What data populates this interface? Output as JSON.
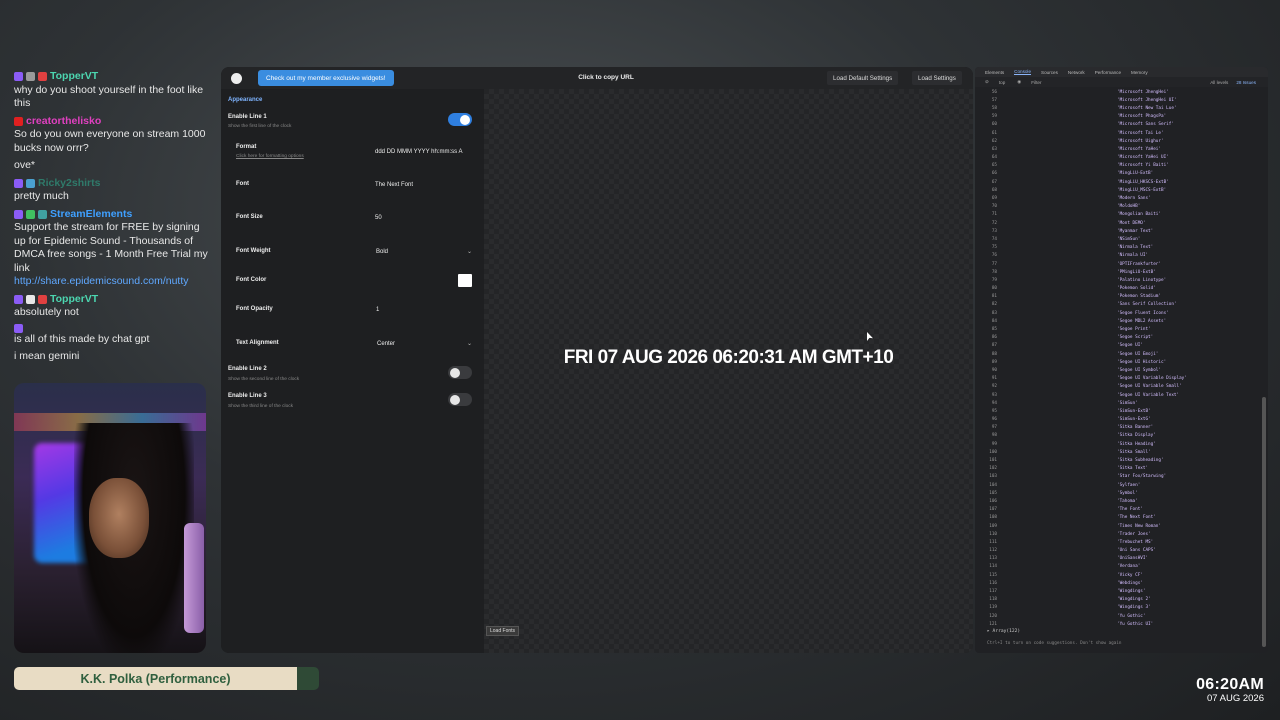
{
  "chat": [
    {
      "user": "TopperVT",
      "color": "#4cd6b0",
      "badges": [
        "#8b5cf6",
        "#9a9a9a",
        "#e04040"
      ],
      "text": "why do you shoot yourself in the foot like this"
    },
    {
      "user": "creatorthelisko",
      "color": "#e040c0",
      "badges": [
        "#e02020"
      ],
      "text": "So do you own everyone on stream 1000 bucks now orrr?"
    },
    {
      "user": "",
      "color": "#ddd",
      "badges": [],
      "text": "ove*"
    },
    {
      "user": "Ricky2shirts",
      "color": "#2f7a6a",
      "badges": [
        "#8b5cf6",
        "#4aa0d0"
      ],
      "text": "pretty much"
    },
    {
      "user": "StreamElements",
      "color": "#3fa0ff",
      "badges": [
        "#8b5cf6",
        "#40c060",
        "#40a0a0"
      ],
      "text": "Support the stream for FREE by signing up for Epidemic Sound - Thousands of DMCA free songs - 1 Month Free Trial my link",
      "link": "http://share.epidemicsound.com/nutty"
    },
    {
      "user": "TopperVT",
      "color": "#4cd6b0",
      "badges": [
        "#8b5cf6",
        "#e8e8e8",
        "#e04040"
      ],
      "text": "absolutely not"
    },
    {
      "user": "",
      "color": "#3a5fd0",
      "badges": [
        "#8b5cf6"
      ],
      "text": "is all of this made by chat gpt"
    },
    {
      "user": "",
      "color": "#ddd",
      "badges": [],
      "text": "i mean gemini"
    }
  ],
  "now_playing": "K.K. Polka (Performance)",
  "clock": {
    "time": "06:20AM",
    "date": "07 AUG 2026"
  },
  "app": {
    "member_button": "Check out my member exclusive widgets!",
    "copy_url": "Click to copy URL",
    "load_default": "Load Default Settings",
    "load_settings": "Load Settings",
    "section": "Appearance",
    "line1_label": "Enable Line 1",
    "line1_sub": "Show the first line of the clock",
    "format_label": "Format",
    "format_sub": "Click here for formatting options",
    "format_value": "ddd DD MMM YYYY hh:mm:ss A",
    "font_label": "Font",
    "font_value": "The Next Font",
    "size_label": "Font Size",
    "size_value": "50",
    "weight_label": "Font Weight",
    "weight_value": "Bold",
    "color_label": "Font Color",
    "color_value": "#ffffff",
    "opacity_label": "Font Opacity",
    "opacity_value": "1",
    "align_label": "Text Alignment",
    "align_value": "Center",
    "line2_label": "Enable Line 2",
    "line2_sub": "Show the second line of the clock",
    "line3_label": "Enable Line 3",
    "line3_sub": "Show the third line of the clock",
    "line1_enabled": true,
    "line2_enabled": false,
    "line3_enabled": false,
    "preview_text": "FRI 07 AUG 2026 06:20:31 AM GMT+10",
    "load_fonts": "Load Fonts"
  },
  "devtools": {
    "tabs": [
      "Elements",
      "Console",
      "Sources",
      "Network",
      "Performance",
      "Memory"
    ],
    "active_tab": "Console",
    "context": "top",
    "filter": "Filter",
    "levels": "All levels",
    "issues": "28 Issues",
    "start_index": 56,
    "fonts": [
      "'Microsoft JhengHei'",
      "'Microsoft JhengHei UI'",
      "'Microsoft New Tai Lue'",
      "'Microsoft PhagsPa'",
      "'Microsoft Sans Serif'",
      "'Microsoft Tai Le'",
      "'Microsoft Uighur'",
      "'Microsoft YaHei'",
      "'Microsoft YaHei UI'",
      "'Microsoft Yi Baiti'",
      "'MingLiU-ExtB'",
      "'MingLiU_HKSCS-ExtB'",
      "'MingLiU_MSCS-ExtB'",
      "'Modern Sans'",
      "'MoldoHB'",
      "'Mongolian Baiti'",
      "'Mont DEMO'",
      "'Myanmar Text'",
      "'NSimSun'",
      "'Nirmala Text'",
      "'Nirmala UI'",
      "'OPTIFrankfurter'",
      "'PMingLiU-ExtB'",
      "'Palatino Linotype'",
      "'Pokemon Solid'",
      "'Pokemon Stadium'",
      "'Sans Serif Collection'",
      "'Segoe Fluent Icons'",
      "'Segoe MDL2 Assets'",
      "'Segoe Print'",
      "'Segoe Script'",
      "'Segoe UI'",
      "'Segoe UI Emoji'",
      "'Segoe UI Historic'",
      "'Segoe UI Symbol'",
      "'Segoe UI Variable Display'",
      "'Segoe UI Variable Small'",
      "'Segoe UI Variable Text'",
      "'SimSun'",
      "'SimSun-ExtB'",
      "'SimSun-ExtG'",
      "'Sitka Banner'",
      "'Sitka Display'",
      "'Sitka Heading'",
      "'Sitka Small'",
      "'Sitka Subheading'",
      "'Sitka Text'",
      "'Star Fox/Starwing'",
      "'Sylfaen'",
      "'Symbol'",
      "'Tahoma'",
      "'The Font'",
      "'The Next Font'",
      "'Times New Roman'",
      "'Trader Joes'",
      "'Trebuchet MS'",
      "'Uni Sans CAPS'",
      "'UniSansHVI'",
      "'Verdana'",
      "'Vicky CF'",
      "'Webdings'",
      "'Wingdings'",
      "'Wingdings 2'",
      "'Wingdings 3'",
      "'Yu Gothic'",
      "'Yu Gothic UI'"
    ],
    "array_label": "▸ Array(122)",
    "hint": "Ctrl+I to turn on code suggestions. Don't show again"
  }
}
